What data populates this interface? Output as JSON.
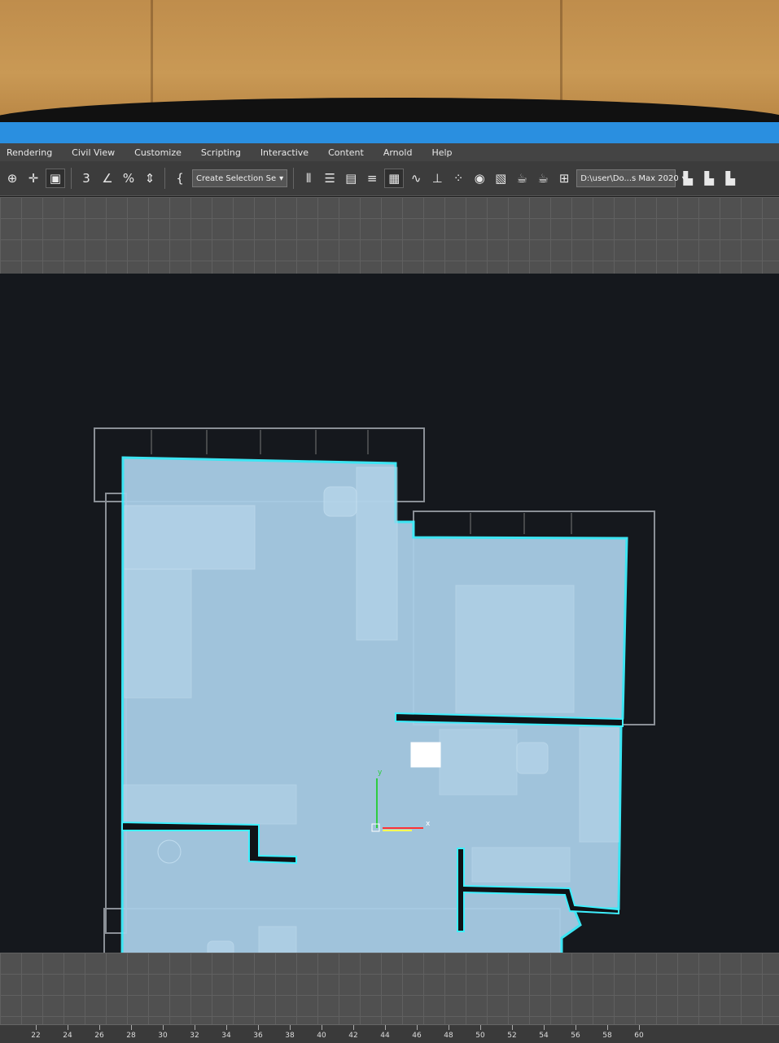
{
  "menu": {
    "items": [
      "Rendering",
      "Civil View",
      "Customize",
      "Scripting",
      "Interactive",
      "Content",
      "Arnold",
      "Help"
    ]
  },
  "toolbar": {
    "selection_set_label": "Create Selection Se",
    "project_path": "D:\\user\\Do...s Max 2020",
    "icons": [
      "snap-toggle-icon",
      "move-icon",
      "select-link-icon",
      "snap-3d-icon",
      "angle-snap-icon",
      "percent-snap-icon",
      "spinner-snap-icon",
      "edit-named-selection-icon",
      "mirror-icon",
      "align-icon",
      "scene-explorer-icon",
      "layer-explorer-icon",
      "ribbon-toggle-icon",
      "curve-editor-icon",
      "dope-sheet-icon",
      "schematic-view-icon",
      "material-editor-icon",
      "render-setup-icon",
      "rendered-frame-window-icon",
      "render-production-icon",
      "render-iterative-icon"
    ]
  },
  "viewport": {
    "axis_x_label": "x",
    "axis_y_label": "y",
    "floorplan_fill": "#a8cde6",
    "floorplan_outline": "#3ff0ff"
  },
  "ruler": {
    "labels": [
      "22",
      "24",
      "26",
      "28",
      "30",
      "32",
      "34",
      "36",
      "38",
      "40",
      "42",
      "44",
      "46",
      "48",
      "50",
      "52",
      "54",
      "56",
      "58",
      "60"
    ]
  },
  "colors": {
    "titlebar": "#2a8fe0",
    "toolbar": "#3c3c3c",
    "viewport_bg": "#15181d"
  }
}
